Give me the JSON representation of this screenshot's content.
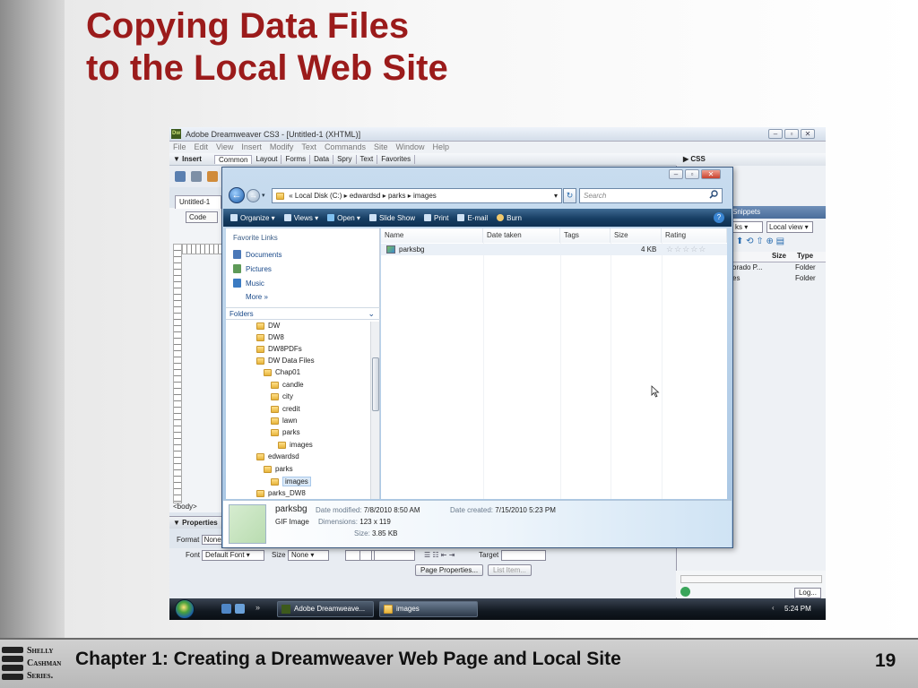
{
  "slide": {
    "title_line1": "Copying Data Files",
    "title_line2": "to the Local Web Site",
    "footer_caption": "Chapter 1: Creating a Dreamweaver Web Page and Local Site",
    "page_number": "19",
    "logo_text": [
      "Shelly",
      "Cashman",
      "Series."
    ]
  },
  "dreamweaver": {
    "logo": "Dw",
    "title": "Adobe Dreamweaver CS3 - [Untitled-1 (XHTML)]",
    "menu": [
      "File",
      "Edit",
      "View",
      "Insert",
      "Modify",
      "Text",
      "Commands",
      "Site",
      "Window",
      "Help"
    ],
    "insert_label": "▼ Insert",
    "insert_tabs": [
      "Common",
      "Layout",
      "Forms",
      "Data",
      "Spry",
      "Text",
      "Favorites"
    ],
    "document_tab": "Untitled-1",
    "code_button": "Code",
    "body_tag": "<body>",
    "properties_label": "▼ Properties",
    "format_label": "Format",
    "format_value": "None",
    "font_label": "Font",
    "font_value": "Default Font",
    "size_label": "Size",
    "size_value": "None",
    "target_label": "Target",
    "page_properties_button": "Page Properties...",
    "list_item_button": "List Item...",
    "css_panel_label": "▶ CSS",
    "snippets_label": "Snippets",
    "ks_value": "ks",
    "local_view_value": "Local view",
    "files_columns": [
      "Size",
      "Type"
    ],
    "files_rows": [
      {
        "name": "orado P...",
        "type": "Folder"
      },
      {
        "name": "es",
        "type": "Folder"
      }
    ],
    "log_button": "Log..."
  },
  "explorer": {
    "address_path": "« Local Disk (C:) ▸ edwardsd ▸ parks ▸ images",
    "search_placeholder": "Search",
    "commands": [
      "Organize ▾",
      "Views ▾",
      "Open ▾",
      "Slide Show",
      "Print",
      "E-mail",
      "Burn"
    ],
    "favorite_links_title": "Favorite Links",
    "favorite_links": [
      "Documents",
      "Pictures",
      "Music",
      "More »"
    ],
    "folders_label": "Folders",
    "tree": [
      {
        "label": "DW",
        "indent": 0
      },
      {
        "label": "DW8",
        "indent": 0
      },
      {
        "label": "DW8PDFs",
        "indent": 0
      },
      {
        "label": "DW Data Files",
        "indent": 0
      },
      {
        "label": "Chap01",
        "indent": 1
      },
      {
        "label": "candle",
        "indent": 2
      },
      {
        "label": "city",
        "indent": 2
      },
      {
        "label": "credit",
        "indent": 2
      },
      {
        "label": "lawn",
        "indent": 2
      },
      {
        "label": "parks",
        "indent": 2
      },
      {
        "label": "images",
        "indent": 3
      },
      {
        "label": "edwardsd",
        "indent": 0
      },
      {
        "label": "parks",
        "indent": 1
      },
      {
        "label": "images",
        "indent": 2,
        "selected": true
      },
      {
        "label": "parks_DW8",
        "indent": 0
      }
    ],
    "columns": [
      "Name",
      "Date taken",
      "Tags",
      "Size",
      "Rating"
    ],
    "files": [
      {
        "name": "parksbg",
        "size": "4 KB",
        "rating": "☆☆☆☆☆"
      }
    ],
    "details": {
      "name": "parksbg",
      "type": "GIF Image",
      "date_modified_label": "Date modified:",
      "date_modified": "7/8/2010 8:50 AM",
      "date_created_label": "Date created:",
      "date_created": "7/15/2010 5:23 PM",
      "dimensions_label": "Dimensions:",
      "dimensions": "123 x 119",
      "size_label": "Size:",
      "size": "3.85 KB"
    }
  },
  "taskbar": {
    "tasks": [
      "Adobe Dreamweave...",
      "images"
    ],
    "clock": "5:24 PM"
  },
  "colors": {
    "title_red": "#9b1b1b",
    "cmdbar_blue": "#173e63",
    "taskbar": "#111820"
  }
}
